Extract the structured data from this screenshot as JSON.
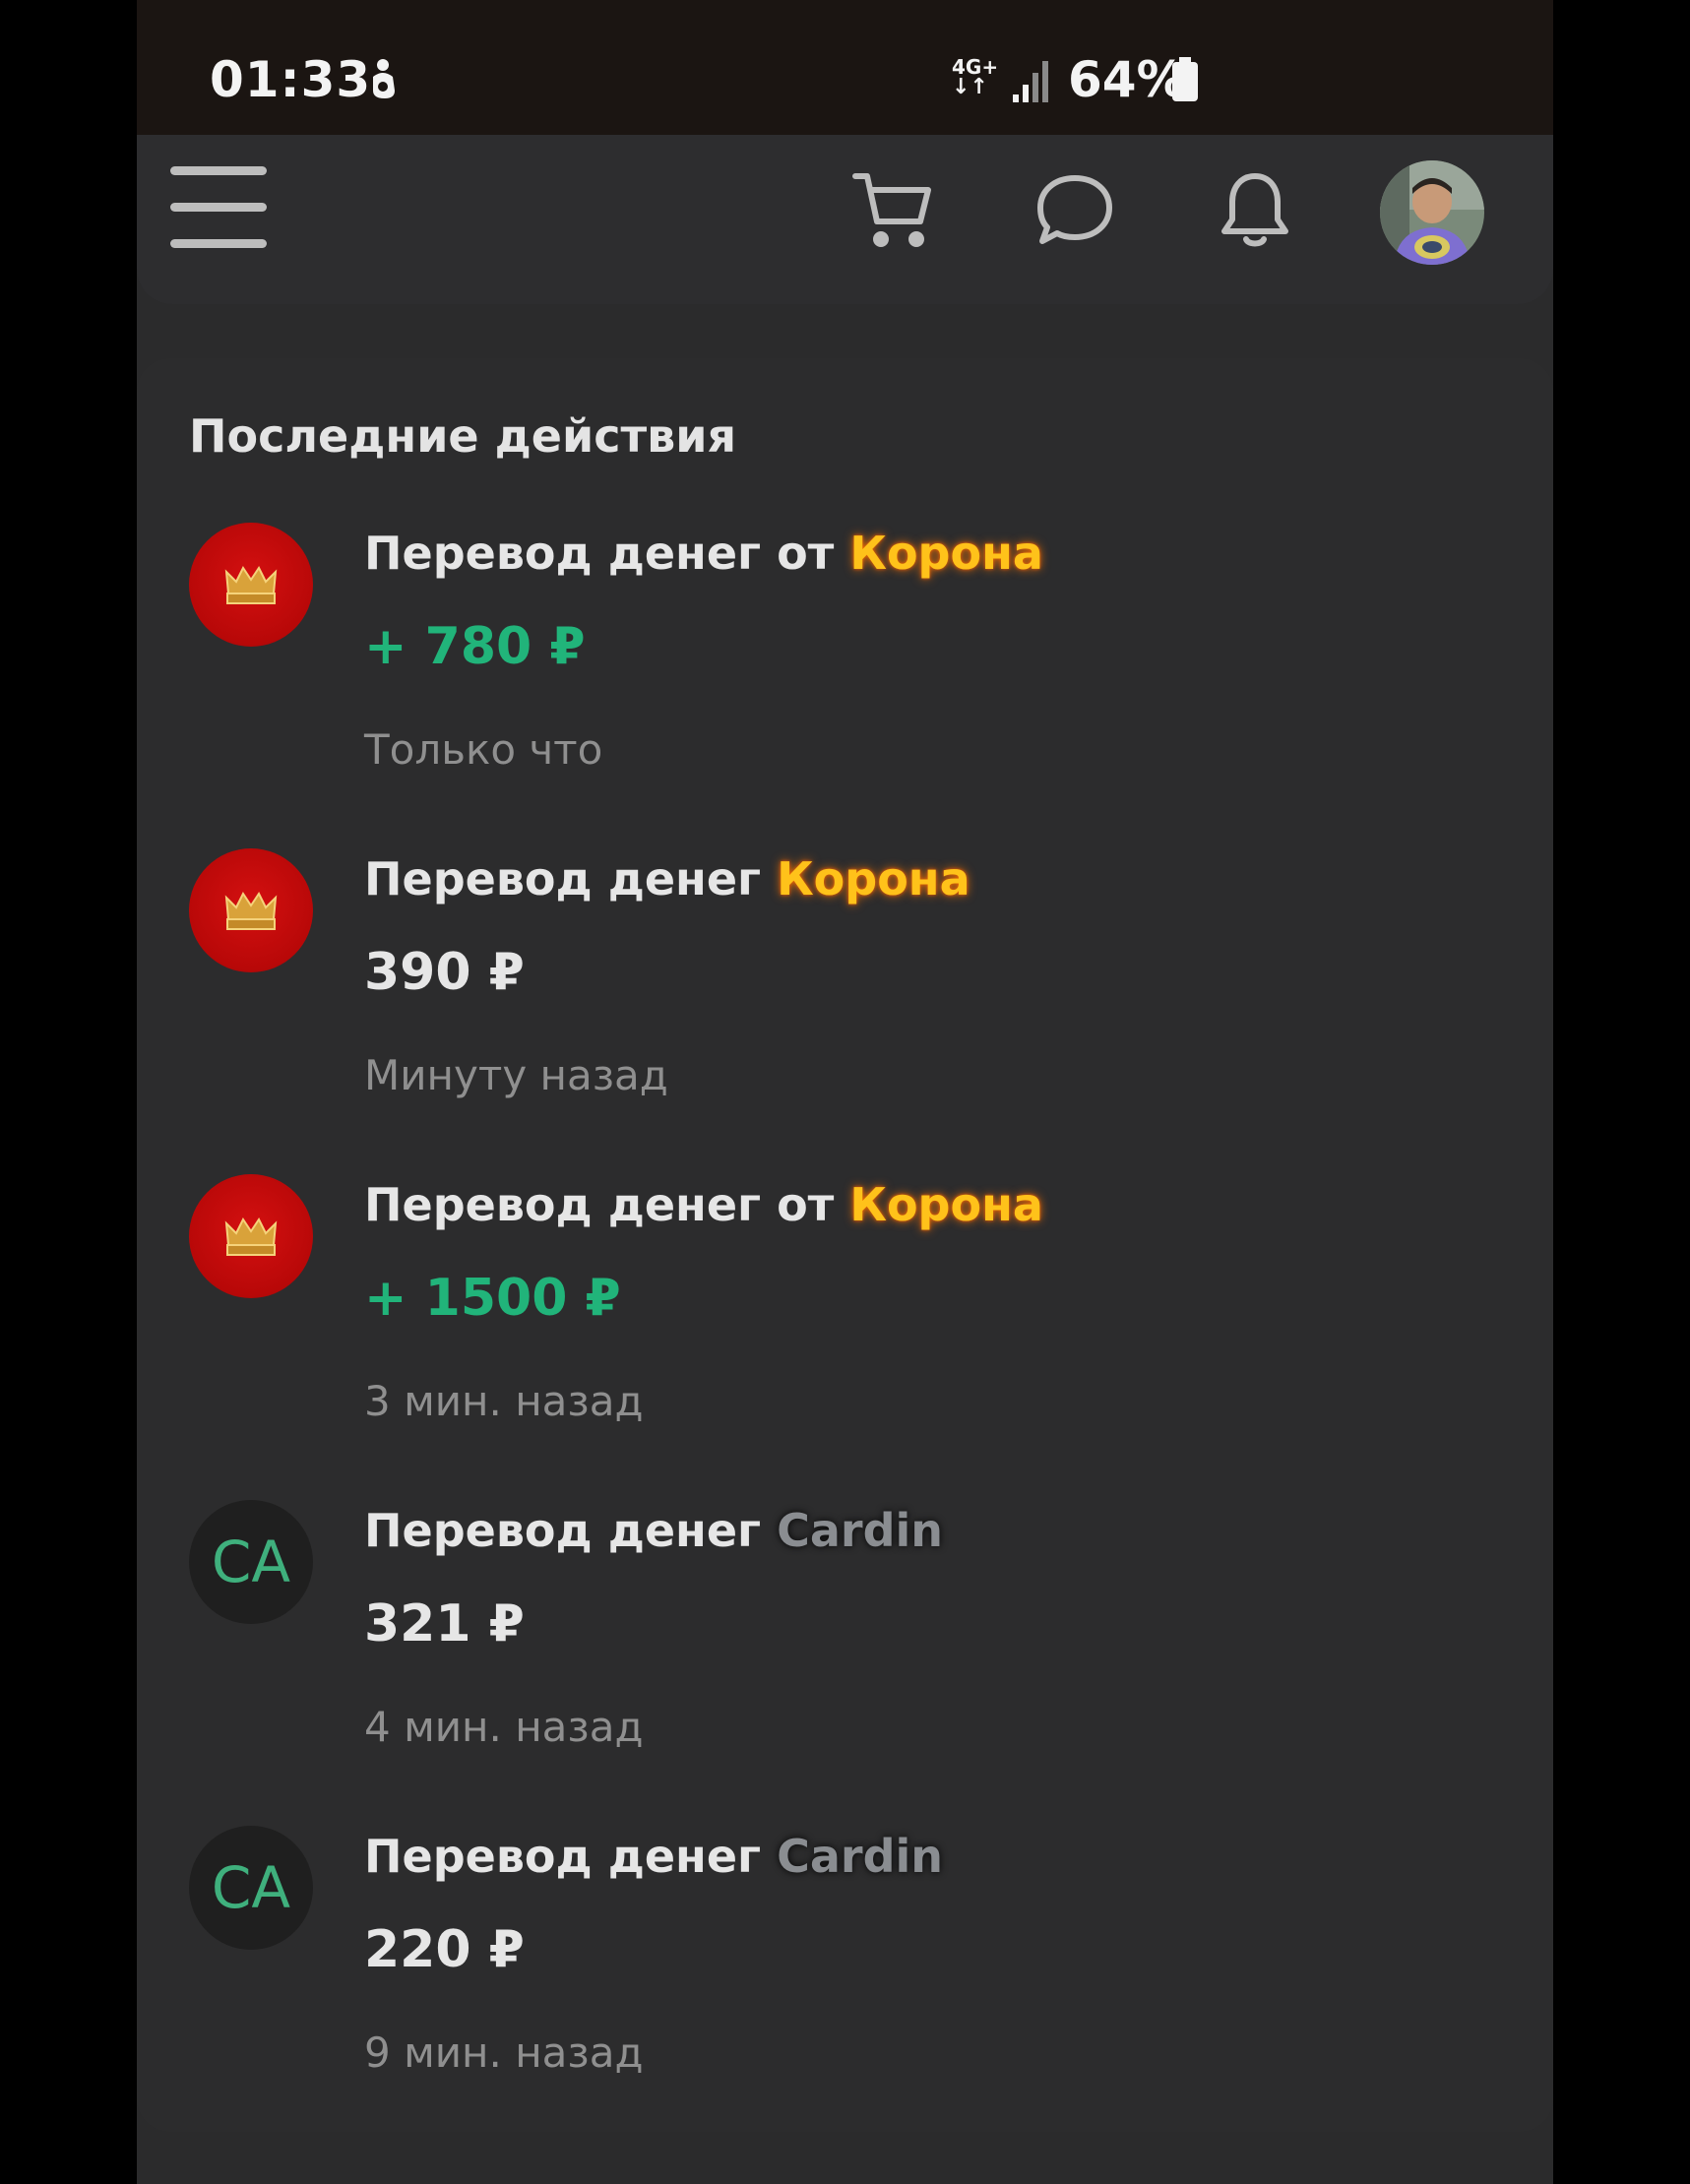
{
  "status_bar": {
    "time": "01:33",
    "network": "4G+",
    "battery": "64%"
  },
  "header": {
    "icons": [
      "menu-icon",
      "cart-icon",
      "chat-icon",
      "bell-icon",
      "user-avatar"
    ]
  },
  "activity": {
    "title": "Последние действия",
    "items": [
      {
        "avatar_type": "crown",
        "prefix": "Перевод денег от",
        "sender": "Корона",
        "sender_style": "gold",
        "amount": "+ 780 ₽",
        "amount_color": "#21b47a",
        "time": "Только что"
      },
      {
        "avatar_type": "crown",
        "prefix": "Перевод денег",
        "sender": "Корона",
        "sender_style": "gold",
        "amount": "390 ₽",
        "amount_color": "#e6e6e6",
        "time": "Минуту назад"
      },
      {
        "avatar_type": "crown",
        "prefix": "Перевод денег от",
        "sender": "Корона",
        "sender_style": "gold",
        "amount": "+ 1500 ₽",
        "amount_color": "#21b47a",
        "time": "3 мин. назад"
      },
      {
        "avatar_type": "initials",
        "initials": "CA",
        "prefix": "Перевод денег",
        "sender": "Cardin",
        "sender_style": "gray",
        "amount": "321 ₽",
        "amount_color": "#e6e6e6",
        "time": "4 мин. назад"
      },
      {
        "avatar_type": "initials",
        "initials": "CA",
        "prefix": "Перевод денег",
        "sender": "Cardin",
        "sender_style": "gray",
        "amount": "220 ₽",
        "amount_color": "#e6e6e6",
        "time": "9 мин. назад"
      }
    ]
  }
}
